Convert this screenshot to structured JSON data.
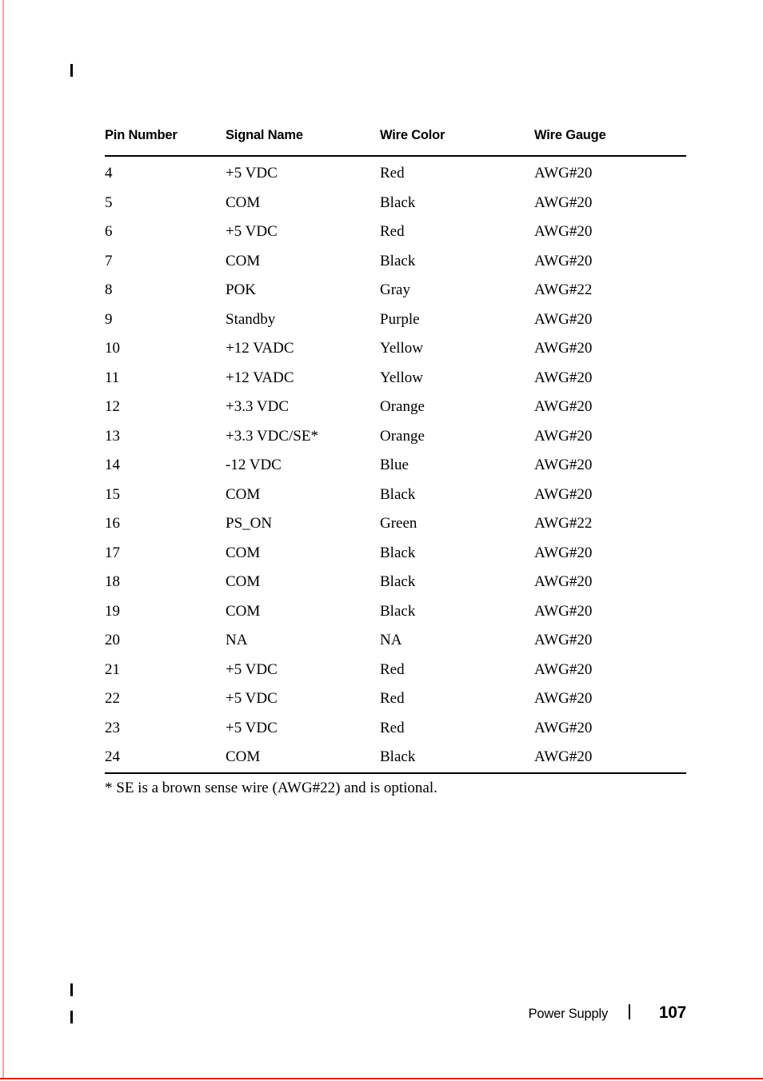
{
  "page": {
    "number": "107",
    "chapter_label": "Power Supply",
    "footer_separator": "|",
    "edge_rule_color": "#ff9d9d",
    "bottom_rule_color": "#e81b1b",
    "change_bar_color": "#000000"
  },
  "table": {
    "headers": [
      "Pin Number",
      "Signal Name",
      "Wire Color",
      "Wire Gauge"
    ],
    "rows": [
      [
        "4",
        "+5 VDC",
        "Red",
        "AWG#20"
      ],
      [
        "5",
        "COM",
        "Black",
        "AWG#20"
      ],
      [
        "6",
        "+5 VDC",
        "Red",
        "AWG#20"
      ],
      [
        "7",
        "COM",
        "Black",
        "AWG#20"
      ],
      [
        "8",
        "POK",
        "Gray",
        "AWG#22"
      ],
      [
        "9",
        "Standby",
        "Purple",
        "AWG#20"
      ],
      [
        "10",
        "+12 VADC",
        "Yellow",
        "AWG#20"
      ],
      [
        "11",
        "+12 VADC",
        "Yellow",
        "AWG#20"
      ],
      [
        "12",
        "+3.3 VDC",
        "Orange",
        "AWG#20"
      ],
      [
        "13",
        "+3.3 VDC/SE*",
        "Orange",
        "AWG#20"
      ],
      [
        "14",
        "-12 VDC",
        "Blue",
        "AWG#20"
      ],
      [
        "15",
        "COM",
        "Black",
        "AWG#20"
      ],
      [
        "16",
        "PS_ON",
        "Green",
        "AWG#22"
      ],
      [
        "17",
        "COM",
        "Black",
        "AWG#20"
      ],
      [
        "18",
        "COM",
        "Black",
        "AWG#20"
      ],
      [
        "19",
        "COM",
        "Black",
        "AWG#20"
      ],
      [
        "20",
        "NA",
        "NA",
        "AWG#20"
      ],
      [
        "21",
        "+5 VDC",
        "Red",
        "AWG#20"
      ],
      [
        "22",
        "+5 VDC",
        "Red",
        "AWG#20"
      ],
      [
        "23",
        "+5 VDC",
        "Red",
        "AWG#20"
      ],
      [
        "24",
        "COM",
        "Black",
        "AWG#20"
      ]
    ],
    "footnote": "* SE is a brown sense wire (AWG#22) and is optional."
  }
}
